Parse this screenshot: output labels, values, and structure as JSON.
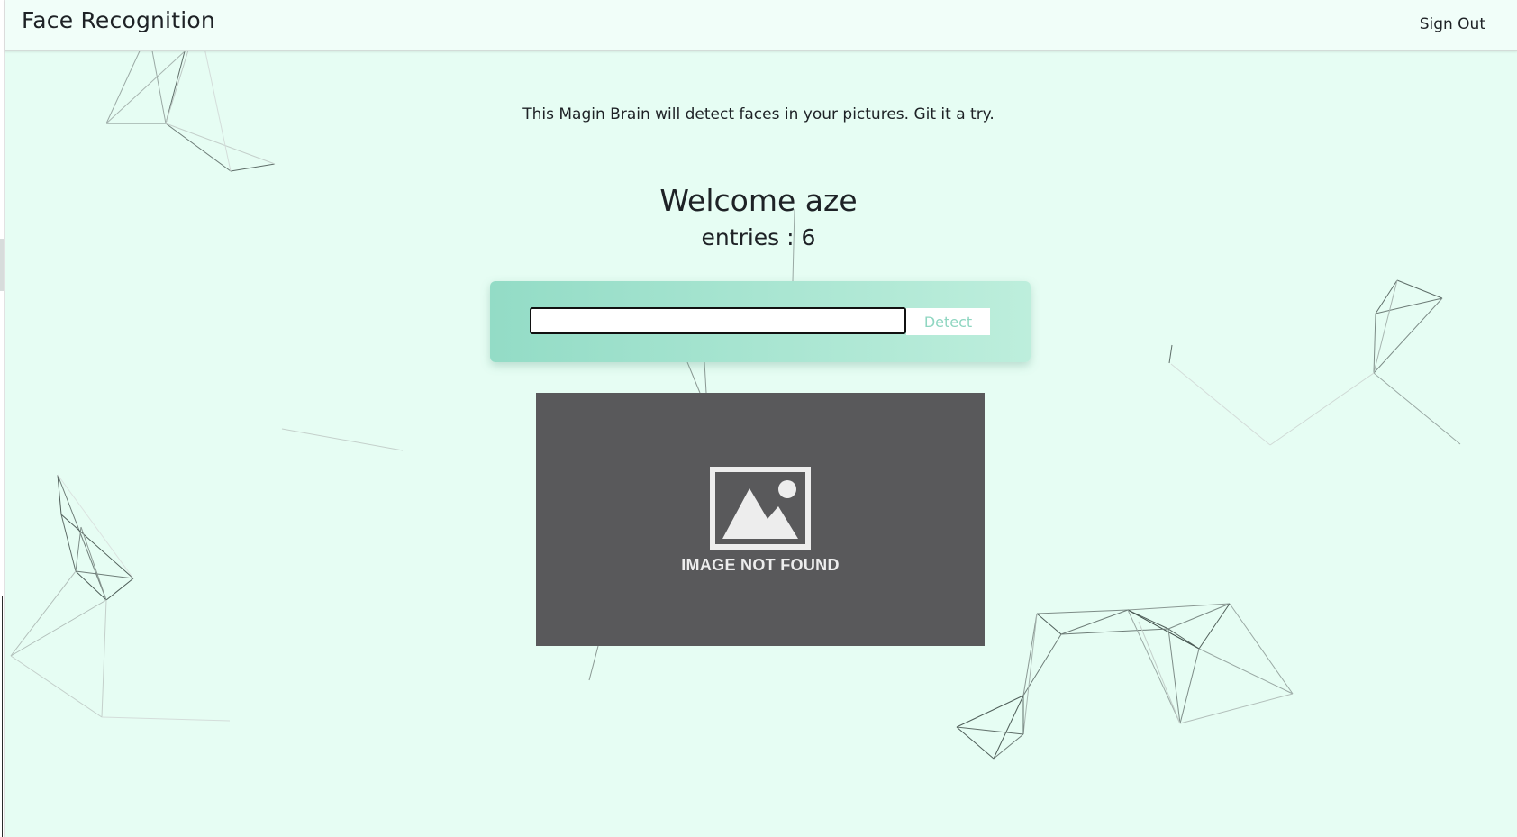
{
  "app": {
    "title": "Face Recognition",
    "sign_out_label": "Sign Out"
  },
  "main": {
    "tagline": "This Magin Brain will detect faces in your pictures. Git it a try.",
    "welcome": "Welcome aze",
    "entries": "entries : 6"
  },
  "form": {
    "url_value": "",
    "url_placeholder": "",
    "detect_label": "Detect"
  },
  "image": {
    "placeholder_text": "IMAGE NOT FOUND",
    "placeholder_icon": "image-placeholder-icon"
  },
  "colors": {
    "background": "#e6fdf3",
    "form_gradient_start": "#93dcc6",
    "form_gradient_end": "#bdeedc",
    "detect_text": "#8fd6c1",
    "image_background": "#59595b"
  }
}
